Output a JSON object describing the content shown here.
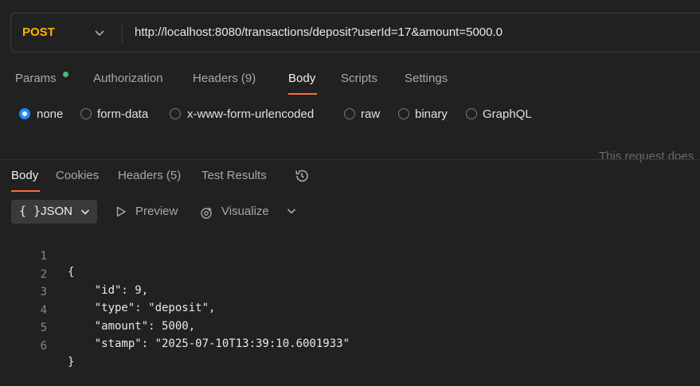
{
  "request": {
    "method": "POST",
    "url": "http://localhost:8080/transactions/deposit?userId=17&amount=5000.0"
  },
  "request_tabs": [
    {
      "label": "Params"
    },
    {
      "label": "Authorization"
    },
    {
      "label": "Headers",
      "count": "(9)"
    },
    {
      "label": "Body"
    },
    {
      "label": "Scripts"
    },
    {
      "label": "Settings"
    }
  ],
  "body_types": [
    "none",
    "form-data",
    "x-www-form-urlencoded",
    "raw",
    "binary",
    "GraphQL"
  ],
  "body_types_selected": "none",
  "hint_text": "This request does",
  "response_tabs": [
    {
      "label": "Body"
    },
    {
      "label": "Cookies"
    },
    {
      "label": "Headers",
      "count": "(5)"
    },
    {
      "label": "Test Results"
    }
  ],
  "response_toolbar": {
    "format_braces": "{ }",
    "format_label": "JSON",
    "preview_label": "Preview",
    "visualize_label": "Visualize"
  },
  "response_body": {
    "line_numbers": [
      "1",
      "2",
      "3",
      "4",
      "5",
      "6"
    ],
    "lines": [
      "{",
      "    \"id\": 9,",
      "    \"type\": \"deposit\",",
      "    \"amount\": 5000,",
      "    \"stamp\": \"2025-07-10T13:39:10.6001933\"",
      "}"
    ]
  },
  "icons": {
    "method_dropdown": "chevron-down-icon",
    "history": "history-icon",
    "preview": "play-icon",
    "visualize": "visualize-icon"
  },
  "colors": {
    "background": "#212121",
    "method": "#ffb400",
    "accent": "#ff6c37",
    "count": "#4fb875",
    "radio_selected": "#1e88ff"
  }
}
